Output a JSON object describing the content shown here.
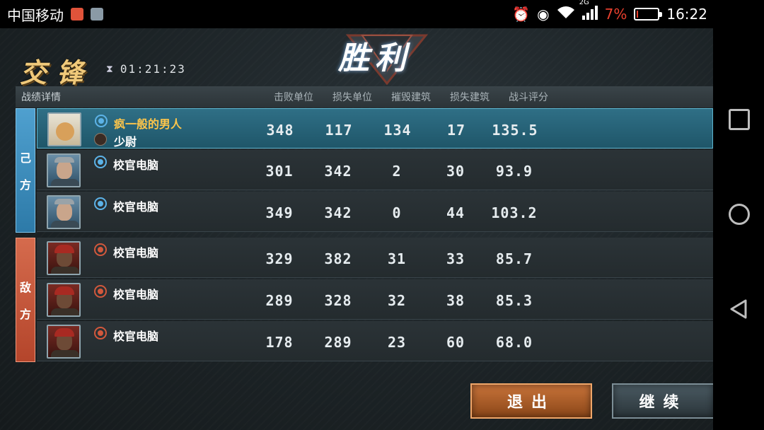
{
  "status_bar": {
    "carrier": "中国移动",
    "network": "2G",
    "battery_percent": "7%",
    "battery_level": 0.07,
    "time": "16:22"
  },
  "game": {
    "mode_title": "交锋",
    "timer": "01:21:23",
    "result": "胜利",
    "header": {
      "title": "战绩详情",
      "columns": [
        "击败单位",
        "损失单位",
        "摧毁建筑",
        "损失建筑",
        "战斗评分"
      ]
    },
    "sides": {
      "ally_label": [
        "己",
        "方"
      ],
      "enemy_label": [
        "敌",
        "方"
      ]
    },
    "players": [
      {
        "name": "疯一般的男人",
        "rank": "少尉",
        "side": "ally",
        "stats": [
          "348",
          "117",
          "134",
          "17",
          "135.5"
        ]
      },
      {
        "name": "校官电脑",
        "rank": "",
        "side": "ally",
        "stats": [
          "301",
          "342",
          "2",
          "30",
          "93.9"
        ]
      },
      {
        "name": "校官电脑",
        "rank": "",
        "side": "ally",
        "stats": [
          "349",
          "342",
          "0",
          "44",
          "103.2"
        ]
      },
      {
        "name": "校官电脑",
        "rank": "",
        "side": "enemy",
        "stats": [
          "329",
          "382",
          "31",
          "33",
          "85.7"
        ]
      },
      {
        "name": "校官电脑",
        "rank": "",
        "side": "enemy",
        "stats": [
          "289",
          "328",
          "32",
          "38",
          "85.3"
        ]
      },
      {
        "name": "校官电脑",
        "rank": "",
        "side": "enemy",
        "stats": [
          "178",
          "289",
          "23",
          "60",
          "68.0"
        ]
      }
    ],
    "buttons": {
      "exit": "退出",
      "continue": "继续"
    },
    "colors": {
      "ally": "#3d8fc0",
      "enemy": "#c75a3c",
      "highlight": "#2a6b82",
      "player_name": "#ffc64a"
    }
  }
}
